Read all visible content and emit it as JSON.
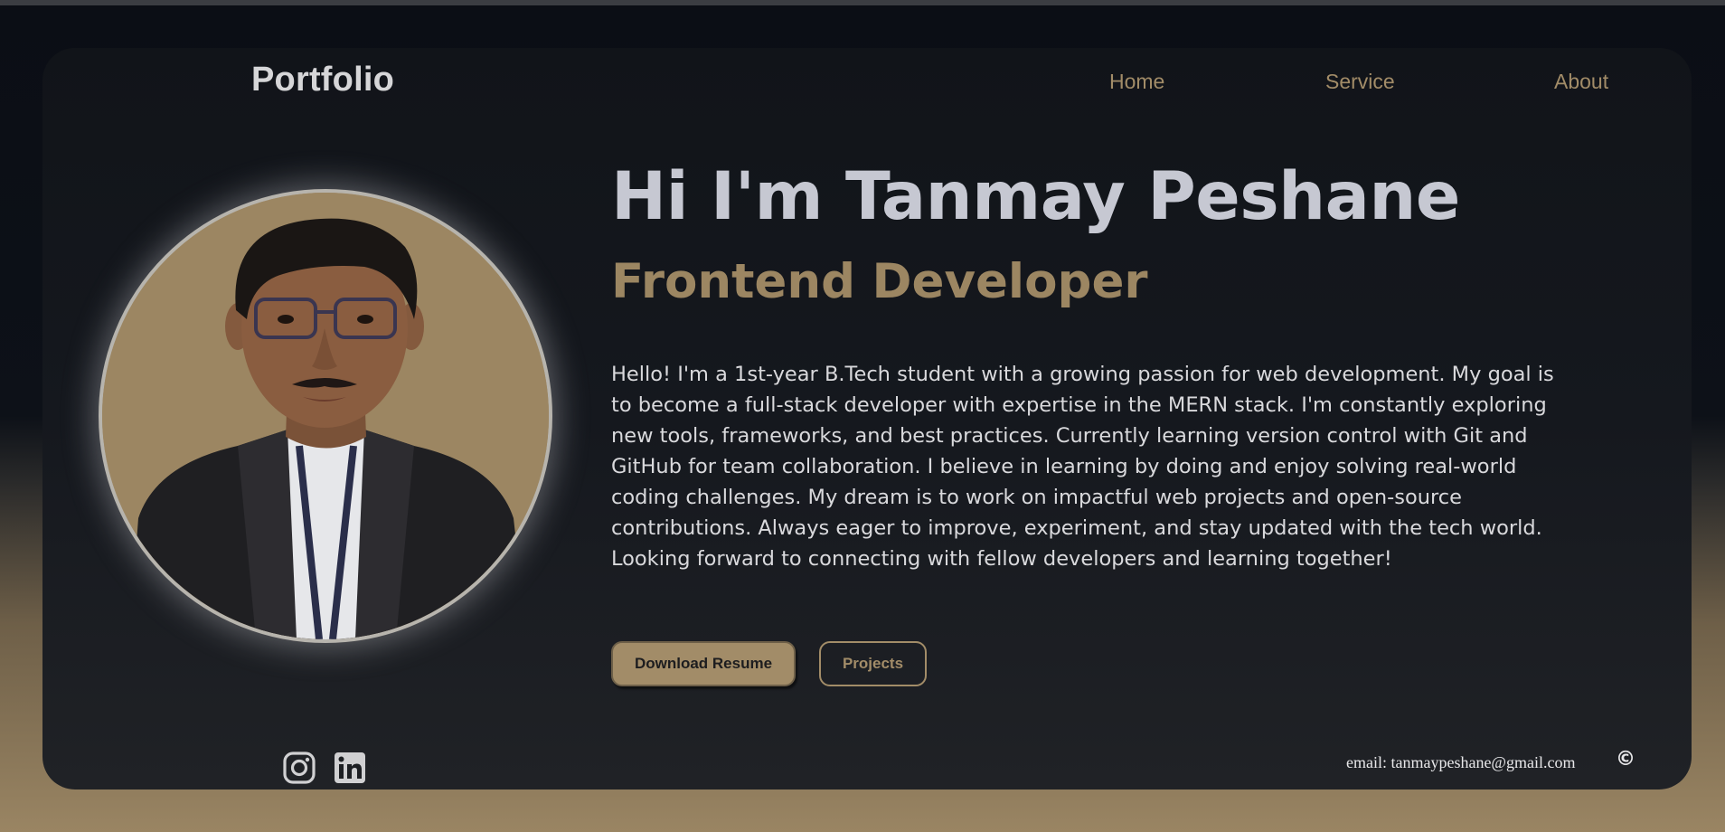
{
  "header": {
    "logo": "Portfolio",
    "nav": [
      {
        "label": "Home"
      },
      {
        "label": "Service"
      },
      {
        "label": "About"
      }
    ]
  },
  "hero": {
    "greeting": "Hi I'm Tanmay Peshane",
    "role": "Frontend Developer",
    "bio": "Hello! I'm a 1st-year B.Tech student with a growing passion for web development. My goal is to become a full-stack developer with expertise in the MERN stack. I'm constantly exploring new tools, frameworks, and best practices. Currently learning version control with Git and GitHub for team collaboration. I believe in learning by doing and enjoy solving real-world coding challenges. My dream is to work on impactful web projects and open-source contributions. Always eager to improve, experiment, and stay updated with the tech world. Looking forward to connecting with fellow developers and learning together!",
    "buttons": {
      "resume": "Download Resume",
      "projects": "Projects"
    }
  },
  "footer": {
    "email": "email: tanmaypeshane@gmail.com",
    "copyright_symbol": "©",
    "social": [
      {
        "icon": "instagram-icon"
      },
      {
        "icon": "linkedin-icon"
      }
    ]
  },
  "colors": {
    "accent": "#a28c68",
    "title": "#c6c8d2",
    "card_bg": "#15181e",
    "page_bg_top": "#0b0e15",
    "page_bg_bottom": "#9a8563"
  }
}
